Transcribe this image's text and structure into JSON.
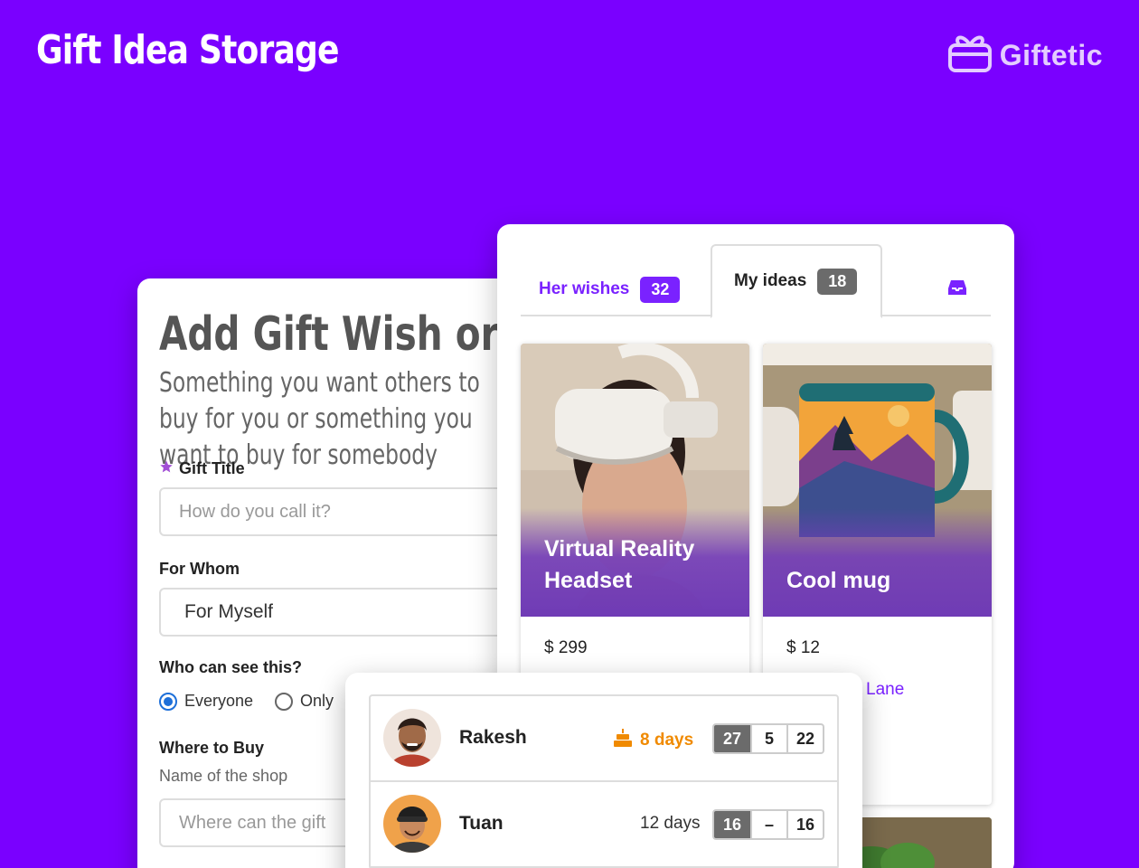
{
  "hero": {
    "title": "Gift Idea Storage"
  },
  "brand": {
    "name": "Giftetic",
    "icon": "gift-box-icon"
  },
  "form": {
    "heading": "Add Gift Wish or Idea",
    "subtitle": "Something you want others to buy for you or something you want to buy for somebody",
    "gift_title": {
      "label": "Gift Title",
      "placeholder": "How do you call it?"
    },
    "for_whom": {
      "label": "For Whom",
      "value": "For Myself"
    },
    "visibility": {
      "label": "Who can see this?",
      "options": [
        "Everyone",
        "Only"
      ],
      "selected": "Everyone"
    },
    "where_to_buy": {
      "label": "Where to Buy",
      "hint": "Name of the shop",
      "placeholder": "Where can the gift"
    }
  },
  "tabs": [
    {
      "label": "Her wishes",
      "count": "32"
    },
    {
      "label": "My ideas",
      "count": "18",
      "active": true
    }
  ],
  "gifts": [
    {
      "title": "Virtual Reality Headset",
      "price": "$ 299"
    },
    {
      "title": "Cool mug",
      "price": "$ 12",
      "shop_fragment": "Lane"
    }
  ],
  "people": [
    {
      "name": "Rakesh",
      "days": "8 days",
      "soon": true,
      "date": [
        "27",
        "5",
        "22"
      ]
    },
    {
      "name": "Tuan",
      "days": "12 days",
      "soon": false,
      "date": [
        "16",
        "–",
        "16"
      ]
    }
  ],
  "colors": {
    "background": "#7a00ff",
    "accent": "#7a22ff",
    "warning": "#f08a00"
  }
}
